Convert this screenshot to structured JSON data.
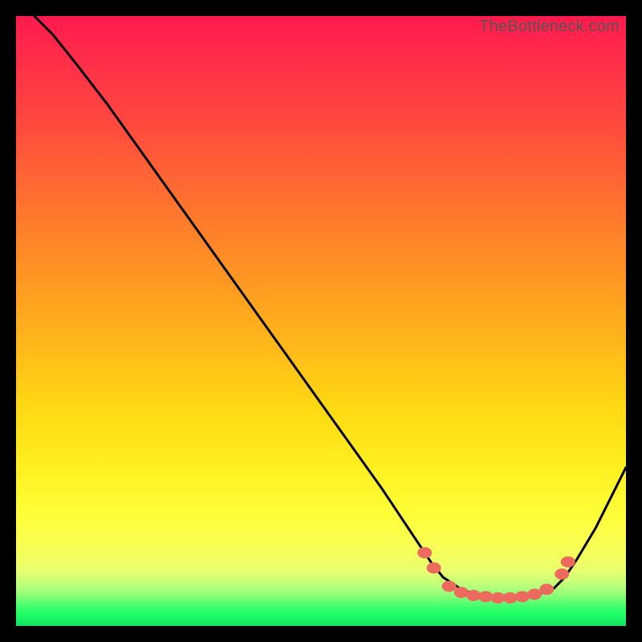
{
  "watermark": "TheBottleneck.com",
  "colors": {
    "top": "#ff1a4d",
    "mid": "#ffd814",
    "bottom": "#14e060",
    "line": "#000000",
    "marker": "#ec6b5e",
    "frame": "#000000"
  },
  "chart_data": {
    "type": "line",
    "title": "",
    "xlabel": "",
    "ylabel": "",
    "xlim": [
      0,
      100
    ],
    "ylim": [
      0,
      100
    ],
    "grid": false,
    "note": "No axis ticks or labels are rendered; values below are estimated from pixel positions on a 0–100 normalized plot. Lower y = closer to green (better). Curve descends from top-left, flattens near bottom around x≈70–88, then rises toward the right edge.",
    "series": [
      {
        "name": "curve",
        "x": [
          3,
          6,
          10,
          15,
          20,
          25,
          30,
          35,
          40,
          45,
          50,
          55,
          60,
          65,
          68,
          70,
          73,
          76,
          79,
          82,
          85,
          88,
          90,
          92,
          95,
          98,
          100
        ],
        "y": [
          100,
          97,
          92,
          85.5,
          78.5,
          71.5,
          64.5,
          57.5,
          50.5,
          43.5,
          36.5,
          29.5,
          22.5,
          15,
          10.5,
          8,
          6,
          5,
          4.5,
          4.5,
          5,
          6,
          8,
          11,
          16,
          22,
          26
        ]
      }
    ],
    "markers": {
      "name": "highlighted-points",
      "note": "Salmon dots clustered near the valley of the curve.",
      "points": [
        {
          "x": 67,
          "y": 12
        },
        {
          "x": 68.5,
          "y": 9.5
        },
        {
          "x": 71,
          "y": 6.5
        },
        {
          "x": 73,
          "y": 5.5
        },
        {
          "x": 75,
          "y": 5
        },
        {
          "x": 77,
          "y": 4.8
        },
        {
          "x": 79,
          "y": 4.6
        },
        {
          "x": 81,
          "y": 4.6
        },
        {
          "x": 83,
          "y": 4.8
        },
        {
          "x": 85,
          "y": 5.2
        },
        {
          "x": 87,
          "y": 6
        },
        {
          "x": 89.5,
          "y": 8.5
        },
        {
          "x": 90.5,
          "y": 10.5
        }
      ]
    }
  }
}
